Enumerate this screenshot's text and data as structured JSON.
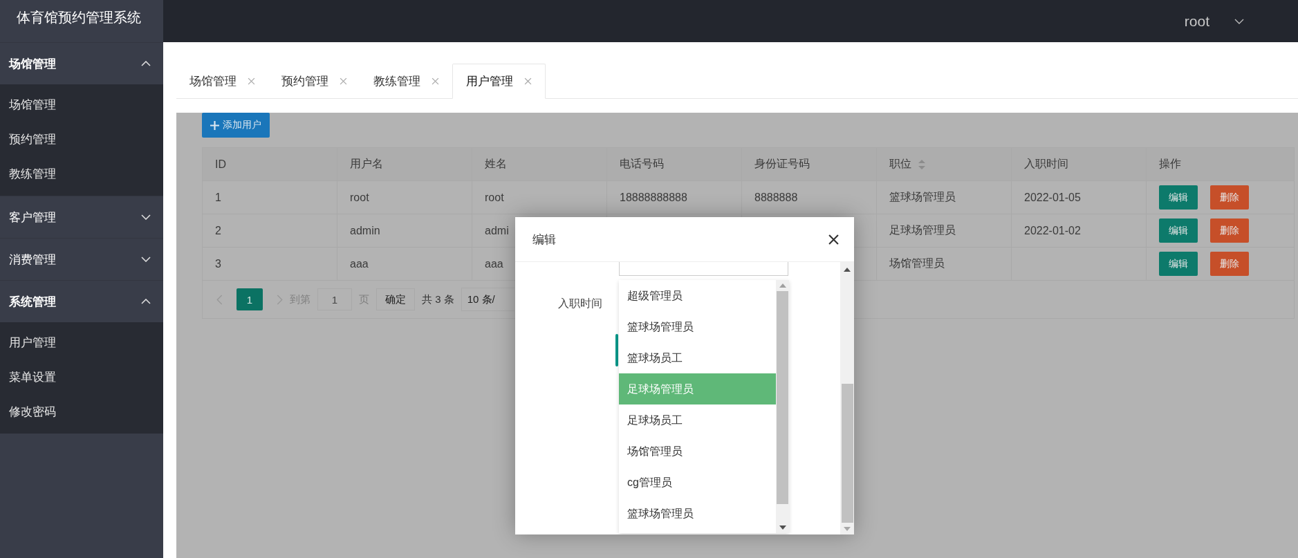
{
  "app": {
    "title": "体育馆预约管理系统"
  },
  "header": {
    "user": "root"
  },
  "sidebar": [
    {
      "label": "场馆管理",
      "expanded": true,
      "children": [
        {
          "label": "场馆管理"
        },
        {
          "label": "预约管理"
        },
        {
          "label": "教练管理"
        }
      ]
    },
    {
      "label": "客户管理",
      "expanded": false
    },
    {
      "label": "消费管理",
      "expanded": false
    },
    {
      "label": "系统管理",
      "expanded": true,
      "children": [
        {
          "label": "用户管理"
        },
        {
          "label": "菜单设置"
        },
        {
          "label": "修改密码"
        }
      ]
    }
  ],
  "tabs": [
    {
      "label": "场馆管理",
      "selected": false
    },
    {
      "label": "预约管理",
      "selected": false
    },
    {
      "label": "教练管理",
      "selected": false
    },
    {
      "label": "用户管理",
      "selected": true
    }
  ],
  "toolbar": {
    "add_button": "添加用户"
  },
  "table": {
    "columns": [
      {
        "label": "ID",
        "sortable": false
      },
      {
        "label": "用户名",
        "sortable": false
      },
      {
        "label": "姓名",
        "sortable": false
      },
      {
        "label": "电话号码",
        "sortable": false
      },
      {
        "label": "身份证号码",
        "sortable": false
      },
      {
        "label": "职位",
        "sortable": true
      },
      {
        "label": "入职时间",
        "sortable": false
      },
      {
        "label": "操作",
        "sortable": false
      }
    ],
    "rows": [
      {
        "cells": [
          "1",
          "root",
          "root",
          "18888888888",
          "8888888",
          "篮球场管理员",
          "2022-01-05"
        ],
        "actions": [
          "编辑",
          "删除"
        ]
      },
      {
        "cells": [
          "2",
          "admin",
          "admi",
          null,
          null,
          "足球场管理员",
          "2022-01-02"
        ],
        "actions": [
          "编辑",
          "删除"
        ]
      },
      {
        "cells": [
          "3",
          "aaa",
          "aaa",
          null,
          null,
          "场馆管理员",
          null
        ],
        "actions": [
          "编辑",
          "删除"
        ]
      }
    ]
  },
  "pagination": {
    "pages": [
      {
        "label": "1",
        "selected": true
      }
    ],
    "goto_label": "到第",
    "goto_value": "1",
    "page_unit": "页",
    "confirm": "确定",
    "total": "共 3 条",
    "page_size": "10 条/"
  },
  "modal": {
    "title": "编辑",
    "field_label": "入职时间",
    "options": [
      {
        "label": "超级管理员",
        "selected": false
      },
      {
        "label": "篮球场管理员",
        "selected": false
      },
      {
        "label": "篮球场员工",
        "selected": false
      },
      {
        "label": "足球场管理员",
        "selected": true
      },
      {
        "label": "足球场员工",
        "selected": false
      },
      {
        "label": "场馆管理员",
        "selected": false
      },
      {
        "label": "cg管理员",
        "selected": false
      },
      {
        "label": "篮球场管理员",
        "selected": false
      }
    ]
  }
}
